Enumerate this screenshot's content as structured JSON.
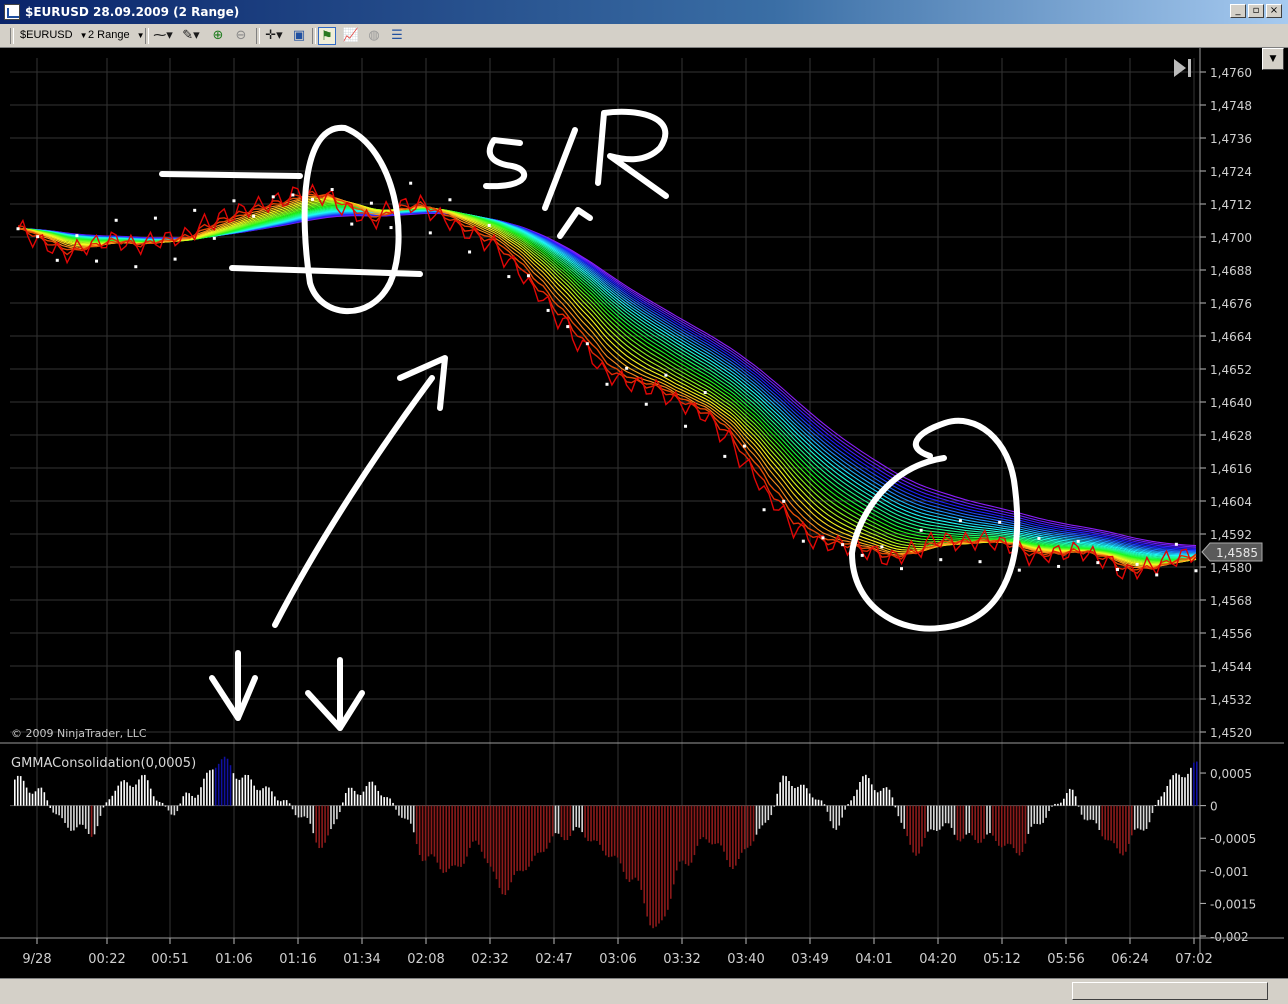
{
  "window": {
    "title": "$EURUSD  28.09.2009 (2 Range)",
    "buttons": [
      "_",
      "▫",
      "×"
    ]
  },
  "toolbar": {
    "instrument": "$EURUSD",
    "period": "2 Range"
  },
  "chart": {
    "copyright": "© 2009 NinjaTrader, LLC",
    "indicator_label": "GMMAConsolidation(0,0005)",
    "current_price_tag": "1,4585",
    "annotation_text": "S/R",
    "colors": {
      "background": "#000000",
      "grid": "#3a3a3a",
      "indicator_positive_strong": "#1010a0",
      "indicator_negative": "#8b1a1a",
      "indicator_neutral": "#ffffff",
      "price_dots": "#ffffff"
    }
  },
  "chart_data": [
    {
      "type": "line",
      "title": "",
      "y_axis_ticks": [
        "1,4760",
        "1,4748",
        "1,4736",
        "1,4724",
        "1,4712",
        "1,4700",
        "1,4688",
        "1,4676",
        "1,4664",
        "1,4652",
        "1,4640",
        "1,4628",
        "1,4616",
        "1,4604",
        "1,4592",
        "1,4580",
        "1,4568",
        "1,4556",
        "1,4544",
        "1,4532",
        "1,4520"
      ],
      "ylim": [
        1.452,
        1.476
      ],
      "x_axis_ticks": [
        "9/28",
        "00:22",
        "00:51",
        "01:06",
        "01:16",
        "01:34",
        "02:08",
        "02:32",
        "02:47",
        "03:06",
        "03:32",
        "03:40",
        "03:49",
        "04:01",
        "04:20",
        "05:12",
        "05:56",
        "06:24",
        "07:02"
      ],
      "series": [
        {
          "values": [
            1.4703,
            1.4698,
            1.4694,
            1.4697,
            1.4699,
            1.4697,
            1.4699,
            1.47,
            1.4705,
            1.4708,
            1.4711,
            1.4713,
            1.4716,
            1.4715,
            1.471,
            1.4706,
            1.4711,
            1.4712,
            1.4707,
            1.4702,
            1.4698,
            1.469,
            1.468,
            1.467,
            1.466,
            1.465,
            1.4647,
            1.4645,
            1.464,
            1.4636,
            1.4628,
            1.4616,
            1.4604,
            1.4594,
            1.4589,
            1.4588,
            1.4586,
            1.4583,
            1.4586,
            1.459,
            1.4589,
            1.459,
            1.4588,
            1.4584,
            1.4585,
            1.4586,
            1.4583,
            1.4578,
            1.458,
            1.4583,
            1.4585
          ]
        }
      ],
      "grid": true
    },
    {
      "type": "bar",
      "title": "GMMAConsolidation(0,0005)",
      "y_axis_ticks": [
        "0,0005",
        "0",
        "-0,0005",
        "-0,001",
        "-0,0015",
        "-0,002"
      ],
      "ylim": [
        -0.002,
        0.0007
      ],
      "values": [
        0.0004,
        0.0002,
        -0.0003,
        -0.0004,
        0.0003,
        0.0004,
        -0.0001,
        0.0002,
        0.0007,
        0.0004,
        0.0002,
        -0.0001,
        -0.0006,
        0.0002,
        0.0003,
        -0.0001,
        -0.0008,
        -0.001,
        -0.0006,
        -0.0013,
        -0.0009,
        -0.0005,
        -0.0004,
        -0.0007,
        -0.0011,
        -0.0019,
        -0.0009,
        -0.0005,
        -0.0009,
        -0.0004,
        0.0004,
        0.0002,
        -0.0003,
        0.0004,
        0.0002,
        -0.0007,
        -0.0003,
        -0.0005,
        -0.0005,
        -0.0007,
        -0.0002,
        0.0002,
        -0.0003,
        -0.0007,
        -0.0003,
        0.0004,
        0.0006
      ]
    }
  ]
}
